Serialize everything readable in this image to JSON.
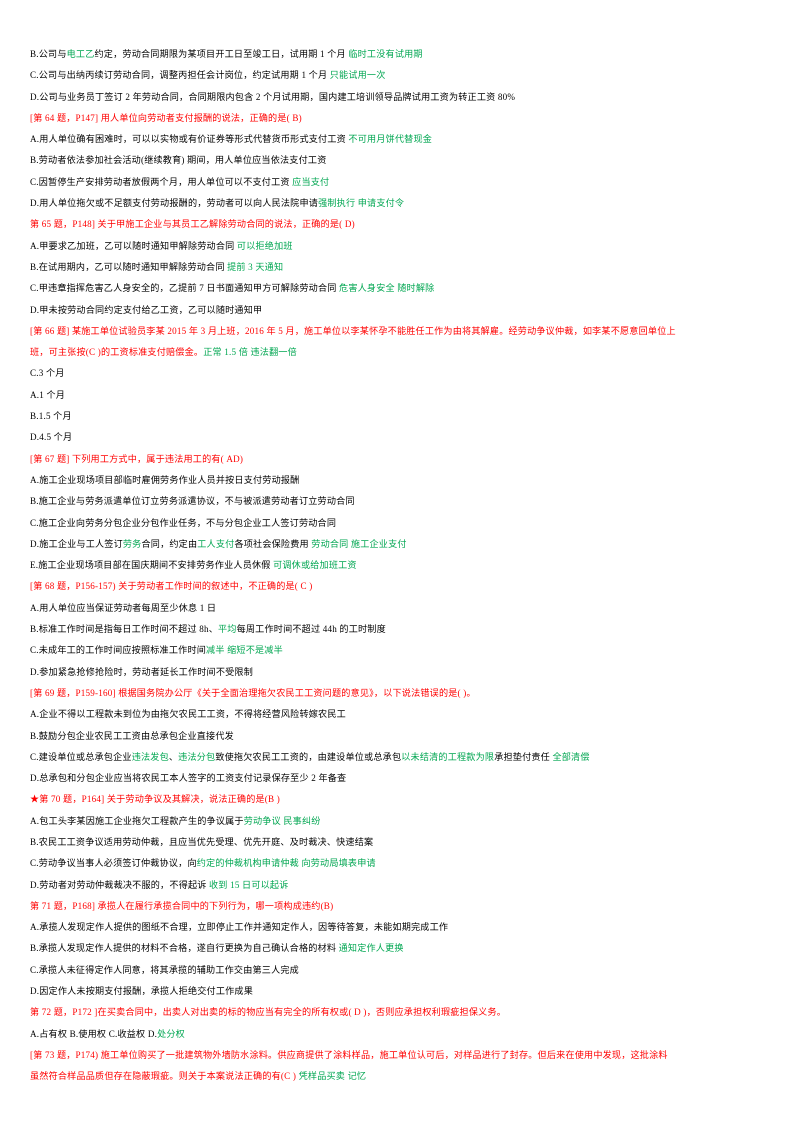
{
  "document": {
    "colors": {
      "body_text": "#000000",
      "question_header": "#ff0000",
      "annotation": "#00a651",
      "page_background": "#ffffff"
    },
    "lines": [
      {
        "id": "l01",
        "type": "option",
        "segments": [
          {
            "text": "B.公司与",
            "color": "black"
          },
          {
            "text": "电工乙",
            "color": "green"
          },
          {
            "text": "约定，劳动合同期限为某项目开工日至竣工日，试用期 1 个月",
            "color": "black"
          },
          {
            "text": "   ",
            "color": "black"
          },
          {
            "text": "临时工没有试用期",
            "color": "green"
          }
        ]
      },
      {
        "id": "l02",
        "type": "option",
        "segments": [
          {
            "text": "C.公司与出纳丙续订劳动合同，调整丙担任会计岗位，约定试用期 1 个月",
            "color": "black"
          },
          {
            "text": "   ",
            "color": "black"
          },
          {
            "text": "只能试用一次",
            "color": "green"
          }
        ]
      },
      {
        "id": "l03",
        "type": "option",
        "segments": [
          {
            "text": "D.公司与业务员丁签订 2 年劳动合同，合同期限内包含 2 个月试用期，国内建工培训领导品牌试用工资为转正工资 80%",
            "color": "black"
          }
        ]
      },
      {
        "id": "l04",
        "type": "question",
        "segments": [
          {
            "text": "[第 64 题，P147]   用人单位向劳动者支付报酬的说法，正确的是( B)",
            "color": "red"
          }
        ]
      },
      {
        "id": "l05",
        "type": "option",
        "segments": [
          {
            "text": "A.用人单位确有困难时，可以以实物或有价证券等形式代替货币形式支付工资",
            "color": "black"
          },
          {
            "text": "   ",
            "color": "black"
          },
          {
            "text": "不可用月饼代替现金",
            "color": "green"
          }
        ]
      },
      {
        "id": "l06",
        "type": "option",
        "segments": [
          {
            "text": "B.劳动者依法参加社会活动(继续教育)  期间，用人单位应当依法支付工资",
            "color": "black"
          }
        ]
      },
      {
        "id": "l07",
        "type": "option",
        "segments": [
          {
            "text": "C.因暂停生产安排劳动者放假两个月，用人单位可以不支付工资",
            "color": "black"
          },
          {
            "text": "   ",
            "color": "black"
          },
          {
            "text": "应当支付",
            "color": "green"
          }
        ]
      },
      {
        "id": "l08",
        "type": "option",
        "segments": [
          {
            "text": "D.用人单位拖欠或不足额支付劳动报酬的，劳动者可以向人民法院申请",
            "color": "black"
          },
          {
            "text": "强制执行",
            "color": "green"
          },
          {
            "text": "  ",
            "color": "black"
          },
          {
            "text": "申请支付令",
            "color": "green"
          }
        ]
      },
      {
        "id": "l09",
        "type": "question",
        "segments": [
          {
            "text": "第 65 题，P148]   关于甲施工企业与其员工乙解除劳动合同的说法，正确的是(  D)",
            "color": "red"
          }
        ]
      },
      {
        "id": "l10",
        "type": "option",
        "segments": [
          {
            "text": "A.甲要求乙加班，乙可以随时通知甲解除劳动合同",
            "color": "black"
          },
          {
            "text": "   ",
            "color": "black"
          },
          {
            "text": "可以拒绝加班",
            "color": "green"
          }
        ]
      },
      {
        "id": "l11",
        "type": "option",
        "segments": [
          {
            "text": "B.在试用期内，乙可以随时通知甲解除劳动合同",
            "color": "black"
          },
          {
            "text": "  ",
            "color": "black"
          },
          {
            "text": "提前 3 天通知",
            "color": "green"
          }
        ]
      },
      {
        "id": "l12",
        "type": "option",
        "segments": [
          {
            "text": "C.甲违章指挥危害乙人身安全的，乙提前 7 日书面通知甲方可解除劳动合同",
            "color": "black"
          },
          {
            "text": "   ",
            "color": "black"
          },
          {
            "text": "危害人身安全 随时解除",
            "color": "green"
          }
        ]
      },
      {
        "id": "l13",
        "type": "option",
        "segments": [
          {
            "text": "D.甲未按劳动合同约定支付给乙工资，乙可以随时通知甲",
            "color": "black"
          }
        ]
      },
      {
        "id": "l14",
        "type": "question",
        "segments": [
          {
            "text": "[第 66 题]   某施工单位试验员李某 2015 年 3 月上班，2016 年 5 月，施工单位以李某怀孕不能胜任工作为由将其解雇。经劳动争议仲裁，如李某不愿意回单位上",
            "color": "red"
          }
        ]
      },
      {
        "id": "l15",
        "type": "question",
        "segments": [
          {
            "text": "班，可主张按(C  )的工资标准支付赔偿金。",
            "color": "red"
          },
          {
            "text": "正常 1.5 倍",
            "color": "green"
          },
          {
            "text": "  ",
            "color": "black"
          },
          {
            "text": "违法翻一倍",
            "color": "green"
          }
        ]
      },
      {
        "id": "l16",
        "type": "option",
        "segments": [
          {
            "text": "C.3 个月",
            "color": "black"
          }
        ]
      },
      {
        "id": "l17",
        "type": "option",
        "segments": [
          {
            "text": "A.1 个月",
            "color": "black"
          }
        ]
      },
      {
        "id": "l18",
        "type": "option",
        "segments": [
          {
            "text": "B.1.5 个月",
            "color": "black"
          }
        ]
      },
      {
        "id": "l19",
        "type": "option",
        "segments": [
          {
            "text": "D.4.5 个月",
            "color": "black"
          }
        ]
      },
      {
        "id": "l20",
        "type": "question",
        "segments": [
          {
            "text": "[第 67 题]   下列用工方式中，属于违法用工的有(  AD)",
            "color": "red"
          }
        ]
      },
      {
        "id": "l21",
        "type": "option",
        "segments": [
          {
            "text": "A.施工企业现场项目部临时雇佣劳务作业人员并按日支付劳动报酬",
            "color": "black"
          }
        ]
      },
      {
        "id": "l22",
        "type": "option",
        "segments": [
          {
            "text": "B.施工企业与劳务派遣单位订立劳务派遣协议，不与被派遣劳动者订立劳动合同",
            "color": "black"
          }
        ]
      },
      {
        "id": "l23",
        "type": "option",
        "segments": [
          {
            "text": "C.施工企业向劳务分包企业分包作业任务，不与分包企业工人签订劳动合同",
            "color": "black"
          }
        ]
      },
      {
        "id": "l24",
        "type": "option",
        "segments": [
          {
            "text": "D.施工企业与工人签订",
            "color": "black"
          },
          {
            "text": "劳务",
            "color": "green"
          },
          {
            "text": "合同，约定由",
            "color": "black"
          },
          {
            "text": "工人支付",
            "color": "green"
          },
          {
            "text": "各项社会保险费用",
            "color": "black"
          },
          {
            "text": "   ",
            "color": "black"
          },
          {
            "text": "劳动合同  施工企业支付",
            "color": "green"
          }
        ]
      },
      {
        "id": "l25",
        "type": "option",
        "segments": [
          {
            "text": "E.施工企业现场项目部在国庆期间不安排劳务作业人员休假",
            "color": "black"
          },
          {
            "text": "   ",
            "color": "black"
          },
          {
            "text": "可调休或给加班工资",
            "color": "green"
          }
        ]
      },
      {
        "id": "l26",
        "type": "question",
        "segments": [
          {
            "text": "[第 68 题，P156-157)   关于劳动者工作时间的叙述中，不正确的是(  C )",
            "color": "red"
          }
        ]
      },
      {
        "id": "l27",
        "type": "option",
        "segments": [
          {
            "text": "A.用人单位应当保证劳动者每周至少休息 1 日",
            "color": "black"
          }
        ]
      },
      {
        "id": "l28",
        "type": "option",
        "segments": [
          {
            "text": "B.标准工作时间是指每日工作时间不超过 8h、",
            "color": "black"
          },
          {
            "text": "平均",
            "color": "green"
          },
          {
            "text": "每周工作时间不超过 44h 的工时制度",
            "color": "black"
          }
        ]
      },
      {
        "id": "l29",
        "type": "option",
        "segments": [
          {
            "text": "C.未成年工的工作时间应按照标准工作时间",
            "color": "black"
          },
          {
            "text": "减半",
            "color": "green"
          },
          {
            "text": "   ",
            "color": "black"
          },
          {
            "text": "缩短不是减半",
            "color": "green"
          }
        ]
      },
      {
        "id": "l30",
        "type": "option",
        "segments": [
          {
            "text": "D.参加紧急抢修抢险时，劳动者延长工作时间不受限制",
            "color": "black"
          }
        ]
      },
      {
        "id": "l31",
        "type": "question",
        "segments": [
          {
            "text": "[第 69 题，P159-160]   根据国务院办公厅《关于全面治理拖欠农民工工资问题的意见》，以下说法错误的是(  )。",
            "color": "red"
          }
        ]
      },
      {
        "id": "l32",
        "type": "option",
        "segments": [
          {
            "text": "A.企业不得以工程款未到位为由拖欠农民工工资，不得将经营风险转嫁农民工",
            "color": "black"
          }
        ]
      },
      {
        "id": "l33",
        "type": "option",
        "segments": [
          {
            "text": "B.鼓励分包企业农民工工资由总承包企业直接代发",
            "color": "black"
          }
        ]
      },
      {
        "id": "l34",
        "type": "option",
        "segments": [
          {
            "text": "C.建设单位或总承包企业",
            "color": "black"
          },
          {
            "text": "违法发包",
            "color": "green"
          },
          {
            "text": "、",
            "color": "black"
          },
          {
            "text": "违法分包",
            "color": "green"
          },
          {
            "text": "致使拖欠农民工工资的，由建设单位或总承包",
            "color": "black"
          },
          {
            "text": "以未结清的工程款为限",
            "color": "green"
          },
          {
            "text": "承担垫付责任",
            "color": "black"
          },
          {
            "text": "  ",
            "color": "black"
          },
          {
            "text": "全部清偿",
            "color": "green"
          }
        ]
      },
      {
        "id": "l35",
        "type": "option",
        "segments": [
          {
            "text": "D.总承包和分包企业应当将农民工本人签字的工资支付记录保存至少 2 年备查",
            "color": "black"
          }
        ]
      },
      {
        "id": "l36",
        "type": "question",
        "segments": [
          {
            "text": "★第 70 题，P164]   关于劳动争议及其解决，说法正确的是(B )",
            "color": "red"
          }
        ]
      },
      {
        "id": "l37",
        "type": "option",
        "segments": [
          {
            "text": "A.包工头李某因施工企业拖欠工程款产生的争议属于",
            "color": "black"
          },
          {
            "text": "劳动争议",
            "color": "green"
          },
          {
            "text": "   ",
            "color": "black"
          },
          {
            "text": "民事纠纷",
            "color": "green"
          }
        ]
      },
      {
        "id": "l38",
        "type": "option",
        "segments": [
          {
            "text": "B.农民工工资争议适用劳动仲裁，且应当优先受理、优先开庭、及时裁决、快速结案",
            "color": "black"
          }
        ]
      },
      {
        "id": "l39",
        "type": "option",
        "segments": [
          {
            "text": "C.劳动争议当事人必须签订仲裁协议，向",
            "color": "black"
          },
          {
            "text": "约定的仲裁机构申请仲裁",
            "color": "green"
          },
          {
            "text": "   ",
            "color": "black"
          },
          {
            "text": "向劳动局填表申请",
            "color": "green"
          }
        ]
      },
      {
        "id": "l40",
        "type": "option",
        "segments": [
          {
            "text": "D.劳动者对劳动仲裁裁决不服的，不得起诉",
            "color": "black"
          },
          {
            "text": "   ",
            "color": "black"
          },
          {
            "text": "收到 15 日可以起诉",
            "color": "green"
          }
        ]
      },
      {
        "id": "l41",
        "type": "question",
        "segments": [
          {
            "text": "第 71 题，P168]   承揽人在履行承揽合同中的下列行为，哪一项构成违约(B)",
            "color": "red"
          }
        ]
      },
      {
        "id": "l42",
        "type": "option",
        "segments": [
          {
            "text": "A.承揽人发现定作人提供的图纸不合理，立即停止工作并通知定作人，因等待答复，未能如期完成工作",
            "color": "black"
          }
        ]
      },
      {
        "id": "l43",
        "type": "option",
        "segments": [
          {
            "text": "B.承揽人发现定作人提供的材料不合格，遂自行更换为自己确认合格的材料",
            "color": "black"
          },
          {
            "text": "   ",
            "color": "black"
          },
          {
            "text": "通知定作人更换",
            "color": "green"
          }
        ]
      },
      {
        "id": "l44",
        "type": "option",
        "segments": [
          {
            "text": "C.承揽人未征得定作人同意，将其承揽的辅助工作交由第三人完成",
            "color": "black"
          }
        ]
      },
      {
        "id": "l45",
        "type": "option",
        "segments": [
          {
            "text": "D.因定作人未按期支付报酬，承揽人拒绝交付工作成果",
            "color": "black"
          }
        ]
      },
      {
        "id": "l46",
        "type": "question",
        "segments": [
          {
            "text": "第 72 题，P172  ]在买卖合同中，出卖人对出卖的标的物应当有完全的所有权或(  D  )，否则应承担权利瑕疵担保义务。",
            "color": "red"
          }
        ]
      },
      {
        "id": "l47",
        "type": "option",
        "segments": [
          {
            "text": "A.占有权",
            "color": "black"
          },
          {
            "text": "   ",
            "color": "black"
          },
          {
            "text": "B.使用权",
            "color": "black"
          },
          {
            "text": "   ",
            "color": "black"
          },
          {
            "text": "C.收益权",
            "color": "black"
          },
          {
            "text": "   ",
            "color": "black"
          },
          {
            "text": "D.",
            "color": "black"
          },
          {
            "text": "处分权",
            "color": "green"
          }
        ]
      },
      {
        "id": "l48",
        "type": "question",
        "segments": [
          {
            "text": "[第 73 题，P174)   施工单位购买了一批建筑物外墙防水涂料。供应商提供了涂料样品，施工单位认可后，对样品进行了封存。但后来在使用中发现，这批涂料",
            "color": "red"
          }
        ]
      },
      {
        "id": "l49",
        "type": "question",
        "segments": [
          {
            "text": "虽然符合样品品质但存在隐蔽瑕疵。则关于本案说法正确的有(C  )",
            "color": "red"
          },
          {
            "text": "  ",
            "color": "black"
          },
          {
            "text": "凭样品买卖  记忆",
            "color": "green"
          }
        ]
      }
    ]
  }
}
